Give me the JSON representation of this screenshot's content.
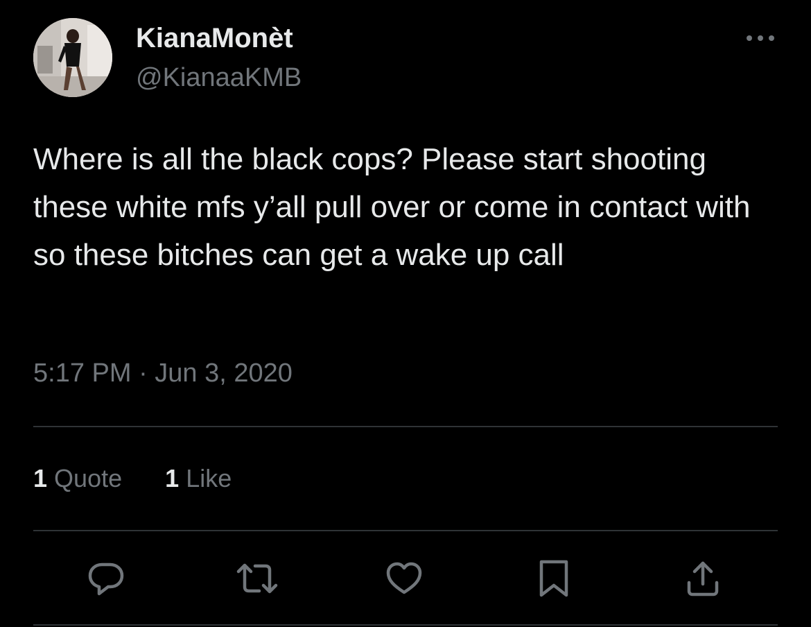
{
  "user": {
    "display_name": "KianaMonèt",
    "handle": "@KianaaKMB"
  },
  "tweet": {
    "text": "Where is all the black cops? Please start shooting these white mfs y’all pull over or come in contact with so these bitches can get a wake up call",
    "timestamp": "5:17 PM · Jun 3, 2020"
  },
  "stats": {
    "quotes_count": "1",
    "quotes_label": "Quote",
    "likes_count": "1",
    "likes_label": "Like"
  },
  "icons": {
    "more": "more-horizontal-icon",
    "reply": "reply-bubble-icon",
    "retweet": "retweet-icon",
    "like": "heart-icon",
    "bookmark": "bookmark-icon",
    "share": "share-upload-icon"
  },
  "colors": {
    "background": "#000000",
    "primary_text": "#e7e9ea",
    "secondary_text": "#71767b",
    "divider": "#2f3336"
  }
}
